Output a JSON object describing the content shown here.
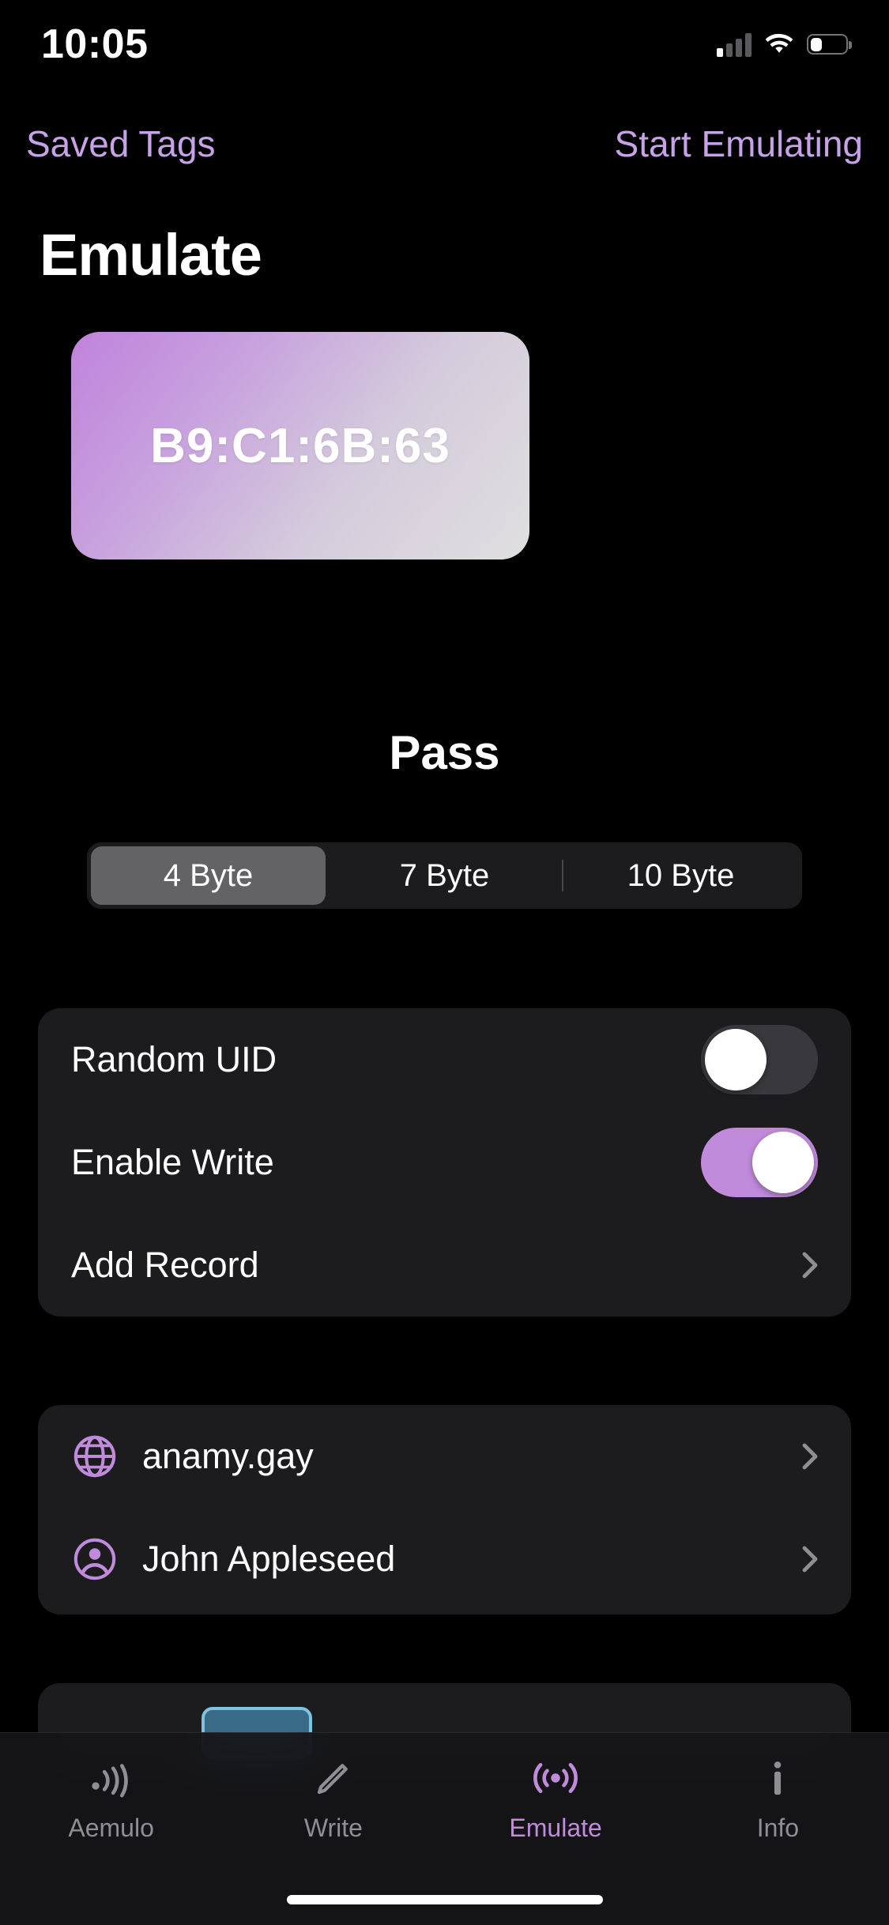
{
  "status_bar": {
    "time": "10:05",
    "signal_icon": "cellular-signal-icon",
    "signal_bars_filled": 1,
    "signal_bars_total": 4,
    "wifi_icon": "wifi-icon",
    "battery_icon": "battery-icon",
    "battery_level_percent": 30
  },
  "nav_bar": {
    "left_button": "Saved Tags",
    "right_button": "Start Emulating"
  },
  "page_title": "Emulate",
  "uid_card": {
    "uid": "B9:C1:6B:63",
    "gradient_from": "#C083DC",
    "gradient_to": "#DFDFDF"
  },
  "tag_name": "Pass",
  "segmented_control": {
    "options": [
      "4 Byte",
      "7 Byte",
      "10 Byte"
    ],
    "selected": "4 Byte",
    "selected_index": 0
  },
  "settings": {
    "rows": [
      {
        "label": "Random UID",
        "type": "toggle",
        "value": "off"
      },
      {
        "label": "Enable Write",
        "type": "toggle",
        "value": "on"
      },
      {
        "label": "Add Record",
        "type": "disclosure",
        "accessory": "chevron-right-icon"
      }
    ]
  },
  "records": {
    "rows": [
      {
        "label": "anamy.gay",
        "icon": "globe-icon",
        "accessory": "chevron-right-icon"
      },
      {
        "label": "John Appleseed",
        "icon": "person-circle-icon",
        "accessory": "chevron-right-icon"
      }
    ]
  },
  "tab_bar": {
    "tabs": [
      {
        "label": "Aemulo",
        "icon": "nfc-wave-icon",
        "active": false
      },
      {
        "label": "Write",
        "icon": "pencil-icon",
        "active": false
      },
      {
        "label": "Emulate",
        "icon": "broadcast-icon",
        "active": true
      },
      {
        "label": "Info",
        "icon": "info-icon",
        "active": false
      }
    ]
  },
  "colors": {
    "accent_purple": "#C08BDB",
    "nav_tint": "#C8A2E8",
    "card_bg": "#1C1C1E",
    "background": "#000000",
    "inactive_tab": "#8E8E93",
    "toggle_off_track": "#39393D",
    "segment_selected": "#636366"
  }
}
